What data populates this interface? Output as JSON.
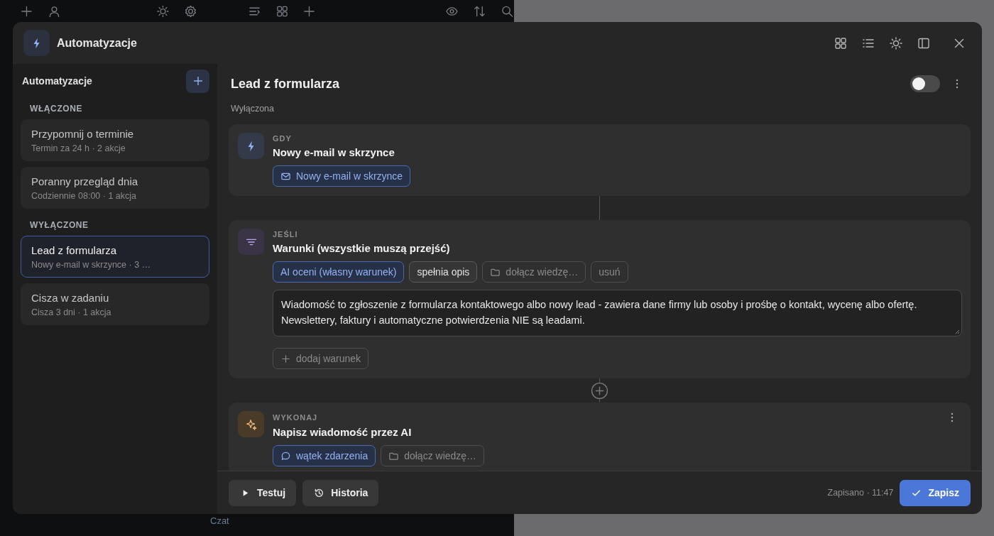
{
  "background": {
    "footer_text": "Czat"
  },
  "window": {
    "title": "Automatyzacje"
  },
  "sidebar": {
    "title": "Automatyzacje",
    "groups": [
      {
        "label": "WŁĄCZONE",
        "items": [
          {
            "name": "Przypomnij o terminie",
            "meta": "Termin za 24 h · 2 akcje",
            "selected": false
          },
          {
            "name": "Poranny przegląd dnia",
            "meta": "Codziennie 08:00 · 1 akcja",
            "selected": false
          }
        ]
      },
      {
        "label": "WYŁĄCZONE",
        "items": [
          {
            "name": "Lead z formularza",
            "meta": "Nowy e-mail w skrzynce · 3 …",
            "selected": true
          },
          {
            "name": "Cisza w zadaniu",
            "meta": "Cisza 3 dni · 1 akcja",
            "selected": false
          }
        ]
      }
    ]
  },
  "detail": {
    "title": "Lead z formularza",
    "status": "Wyłączona",
    "enabled": false,
    "steps": [
      {
        "kind": "trigger",
        "label": "GDY",
        "title": "Nowy e-mail w skrzynce",
        "menu": false,
        "chips": [
          {
            "kind": "event",
            "text": "Nowy e-mail w skrzynce"
          }
        ]
      },
      {
        "kind": "condition",
        "label": "JEŚLI",
        "title": "Warunki (wszystkie muszą przejść)",
        "menu": false,
        "chips": [
          {
            "kind": "ai",
            "text": "AI oceni (własny warunek)"
          },
          {
            "kind": "option",
            "text": "spełnia opis"
          },
          {
            "kind": "knowledge",
            "text": "dołącz wiedzę…"
          },
          {
            "kind": "remove",
            "text": "usuń"
          }
        ],
        "text": "Wiadomość to zgłoszenie z formularza kontaktowego albo nowy lead - zawiera dane firmy lub osoby i prośbę o kontakt, wycenę albo ofertę. Newslettery, faktury i automatyczne potwierdzenia NIE są leadami.",
        "add_label": "dodaj warunek"
      },
      {
        "kind": "action",
        "label": "WYKONAJ",
        "title": "Napisz wiadomość przez AI",
        "menu": true,
        "chips": [
          {
            "kind": "thread",
            "text": "wątek zdarzenia"
          },
          {
            "kind": "knowledge",
            "text": "dołącz wiedzę…"
          }
        ]
      }
    ]
  },
  "footer": {
    "test_label": "Testuj",
    "history_label": "Historia",
    "saved_text": "Zapisano · 11:47",
    "save_label": "Zapisz"
  }
}
